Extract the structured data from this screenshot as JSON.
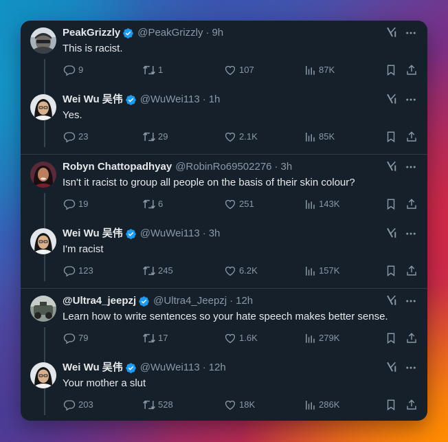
{
  "threads": [
    {
      "tweets": [
        {
          "name": "PeakGrizzly",
          "handle": "@PeakGrizzly",
          "time": "9h",
          "text": "This is racist.",
          "replies": "9",
          "retweets": "1",
          "likes": "107",
          "views": "87K",
          "avatar": "peakgrizzly-avatar"
        },
        {
          "name": "Wei Wu 吴伟",
          "handle": "@WuWei113",
          "time": "1h",
          "text": "Yes.",
          "replies": "23",
          "retweets": "29",
          "likes": "2.1K",
          "views": "85K",
          "avatar": "weiwu-avatar"
        }
      ]
    },
    {
      "tweets": [
        {
          "name": "Robyn Chattopadhyay",
          "handle": "@RobinRo69502276",
          "time": "3h",
          "text": "Isn't it racist to group all people on the basis of their skin colour?",
          "replies": "19",
          "retweets": "6",
          "likes": "251",
          "views": "143K",
          "avatar": "robyn-avatar"
        },
        {
          "name": "Wei Wu 吴伟",
          "handle": "@WuWei113",
          "time": "3h",
          "text": "I'm racist",
          "replies": "123",
          "retweets": "245",
          "likes": "6.2K",
          "views": "157K",
          "avatar": "weiwu-avatar"
        }
      ]
    },
    {
      "tweets": [
        {
          "name": "@Ultra4_jeepzj",
          "handle": "@Ultra4_Jeepzj",
          "time": "12h",
          "text": "Learn how to write sentences so your hate speech makes better sense.",
          "replies": "79",
          "retweets": "17",
          "likes": "1.6K",
          "views": "279K",
          "avatar": "ultra4-avatar"
        },
        {
          "name": "Wei Wu 吴伟",
          "handle": "@WuWei113",
          "time": "12h",
          "text": "Your mother a slut",
          "replies": "203",
          "retweets": "528",
          "likes": "18K",
          "views": "286K",
          "avatar": "weiwu-avatar"
        }
      ]
    }
  ],
  "separator": "·",
  "colors": {
    "background": "#15202b",
    "text": "#e7e9ea",
    "secondary": "#8b98a5",
    "verified": "#1d9bf0",
    "divider": "#2f3b47"
  },
  "icons": [
    "verified-badge-icon",
    "grok-icon",
    "more-icon",
    "reply-icon",
    "retweet-icon",
    "like-icon",
    "views-icon",
    "bookmark-icon",
    "share-icon"
  ]
}
